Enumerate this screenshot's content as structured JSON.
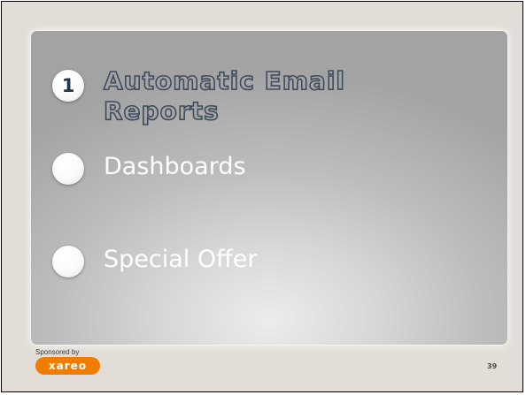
{
  "slide": {
    "items": [
      {
        "number": "1",
        "label_line1": "Automatic Email",
        "label_line2": "Reports",
        "state": "active"
      },
      {
        "number": "",
        "label": "Dashboards",
        "state": "inactive"
      },
      {
        "number": "",
        "label": "Special Offer",
        "state": "inactive"
      }
    ],
    "colors": {
      "frame_background": "#e2ddd6",
      "active_text_fill": "#a6a6a6",
      "active_text_outline": "#3e4c5e",
      "bullet_number": "#1f3552",
      "brand_orange": "#f07d00"
    }
  },
  "footer": {
    "sponsored_text": "Sponsored by",
    "brand_logo_text": "xareo",
    "page_number": "39"
  }
}
